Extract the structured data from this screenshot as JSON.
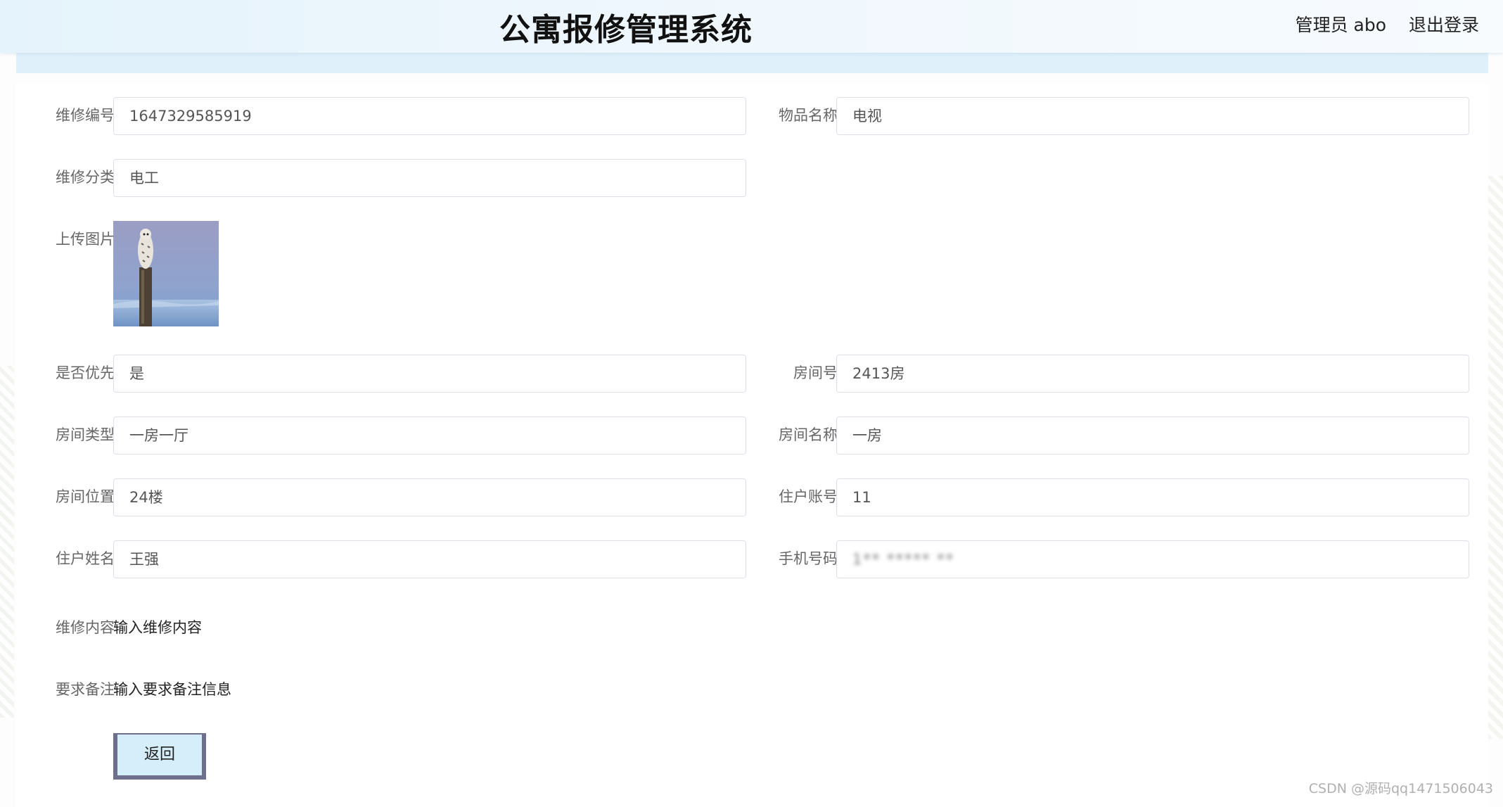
{
  "header": {
    "title": "公寓报修管理系统",
    "user": "管理员 abo",
    "logout": "退出登录"
  },
  "form": {
    "repair_no": {
      "label": "维修编号",
      "value": "1647329585919"
    },
    "item_name": {
      "label": "物品名称",
      "value": "电视"
    },
    "category": {
      "label": "维修分类",
      "value": "电工"
    },
    "upload_image": {
      "label": "上传图片",
      "image_subject": "owl-on-post-in-snow"
    },
    "priority": {
      "label": "是否优先",
      "value": "是"
    },
    "room_no": {
      "label": "房间号",
      "value": "2413房"
    },
    "room_type": {
      "label": "房间类型",
      "value": "一房一厅"
    },
    "room_name": {
      "label": "房间名称",
      "value": "一房"
    },
    "room_location": {
      "label": "房间位置",
      "value": "24楼"
    },
    "tenant_account": {
      "label": "住户账号",
      "value": "11"
    },
    "tenant_name": {
      "label": "住户姓名",
      "value": "王强"
    },
    "phone": {
      "label": "手机号码",
      "value": "1** ***** **"
    },
    "repair_content": {
      "label": "维修内容",
      "value": "输入维修内容"
    },
    "remarks": {
      "label": "要求备注",
      "value": "输入要求备注信息"
    }
  },
  "actions": {
    "back": "返回"
  },
  "watermark": "CSDN @源码qq1471506043",
  "colors": {
    "header_bg": "#e5f3fc",
    "breadcrumb_bg": "#dff0fb",
    "back_button_bg": "#d6eef9",
    "back_button_border": "#6e6f8d"
  }
}
